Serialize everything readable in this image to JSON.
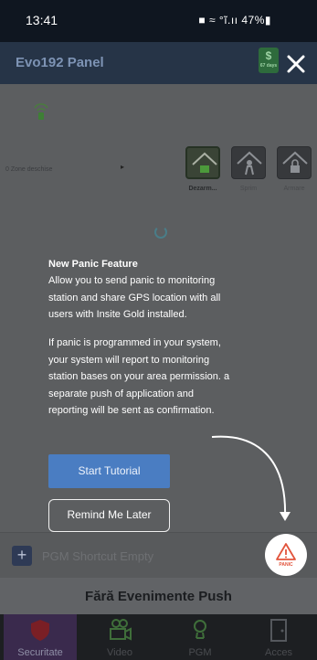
{
  "status_bar": {
    "time": "13:41",
    "indicators": "■ ≈ °ĩ.ıı 47%▮"
  },
  "app_bar": {
    "title": "Evo192 Panel",
    "credit_symbol": "$",
    "credit_text": "67 days",
    "menu_icon": "hamburger-icon"
  },
  "panel": {
    "zone_text": "0 Zone deschise",
    "arrow": "▸",
    "modes": [
      {
        "label": "Dezarm...",
        "icon": "house-unlocked-icon",
        "active": true
      },
      {
        "label": "Sprim",
        "icon": "person-home-icon",
        "active": false
      },
      {
        "label": "Armare",
        "icon": "house-locked-icon",
        "active": false
      }
    ]
  },
  "shortcut": {
    "plus": "+",
    "label": "PGM Shortcut Empty"
  },
  "push_bar": {
    "text": "Fără Evenimente Push"
  },
  "tabs": [
    {
      "label": "Securitate",
      "icon": "shield-icon",
      "active": true
    },
    {
      "label": "Video",
      "icon": "camera-icon",
      "active": false
    },
    {
      "label": "PGM",
      "icon": "bulb-icon",
      "active": false
    },
    {
      "label": "Acces",
      "icon": "door-icon",
      "active": false
    }
  ],
  "tutorial": {
    "title": "New Panic Feature",
    "paragraph1": "Allow you to send panic to monitoring station and share GPS location with all users with Insite Gold installed.",
    "paragraph2": "If panic is programmed in your system, your system will report to monitoring station bases on your area permission. a separate push of application and reporting will be sent as confirmation.",
    "start_button": "Start Tutorial",
    "later_button": "Remind Me Later",
    "panic_label": "PANIC",
    "colors": {
      "accent": "#4a7dc2",
      "panic": "#e2543c"
    }
  }
}
